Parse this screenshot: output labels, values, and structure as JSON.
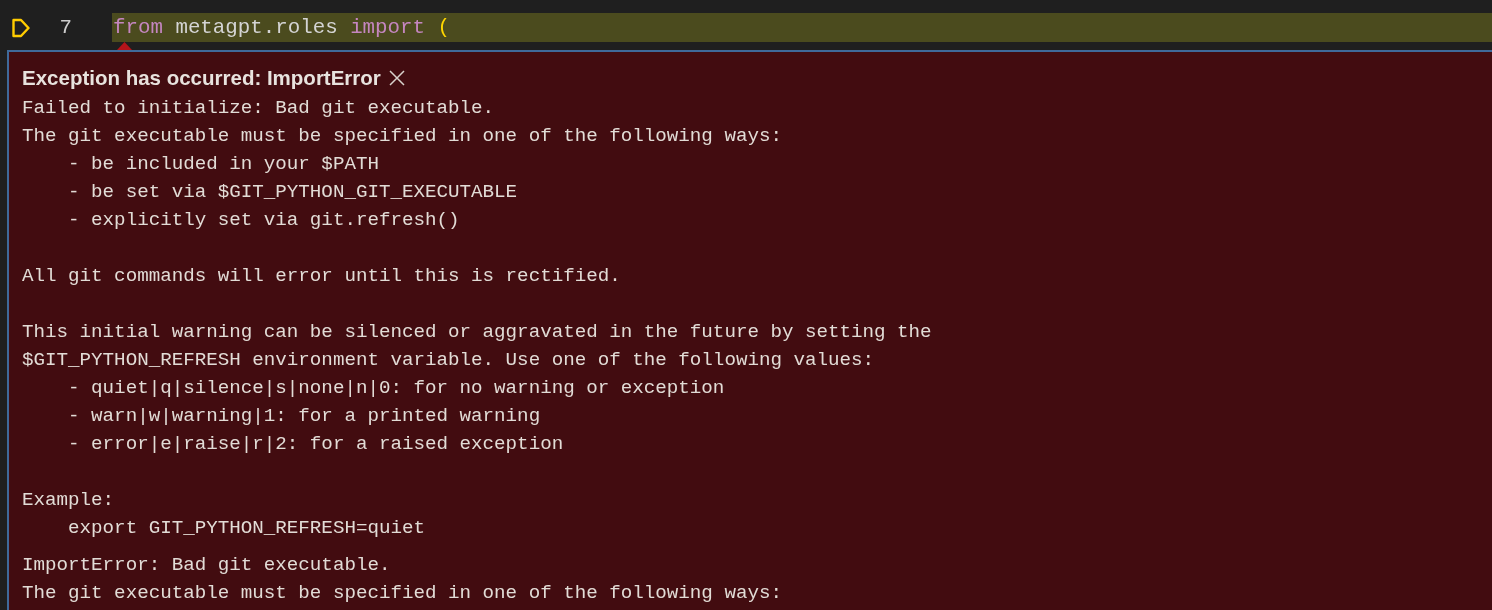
{
  "editor": {
    "lines": [
      {
        "number": "7",
        "current": true,
        "tokens": [
          {
            "text": "from",
            "kind": "keyword"
          },
          {
            "text": " metagpt.roles ",
            "kind": "plain"
          },
          {
            "text": "import",
            "kind": "keyword"
          },
          {
            "text": " (",
            "kind": "bracket"
          }
        ]
      }
    ]
  },
  "exception": {
    "title": "Exception has occurred: ImportError",
    "description": "Failed to initialize: Bad git executable.\nThe git executable must be specified in one of the following ways:\n    - be included in your $PATH\n    - be set via $GIT_PYTHON_GIT_EXECUTABLE\n    - explicitly set via git.refresh()\n\nAll git commands will error until this is rectified.\n\nThis initial warning can be silenced or aggravated in the future by setting the\n$GIT_PYTHON_REFRESH environment variable. Use one of the following values:\n    - quiet|q|silence|s|none|n|0: for no warning or exception\n    - warn|w|warning|1: for a printed warning\n    - error|e|raise|r|2: for a raised exception\n\nExample:\n    export GIT_PYTHON_REFRESH=quiet",
    "stack_trace": "ImportError: Bad git executable.\nThe git executable must be specified in one of the following ways:"
  }
}
